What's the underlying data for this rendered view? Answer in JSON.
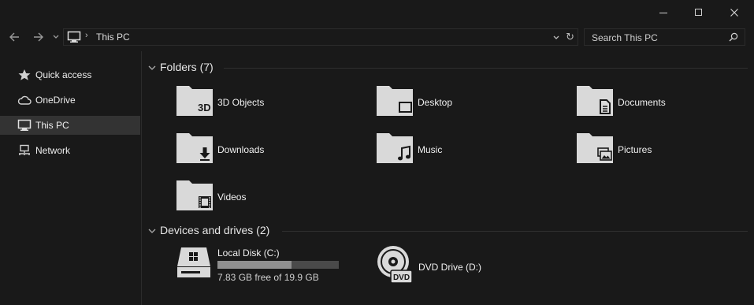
{
  "window": {
    "minimize_icon": "minimize-icon",
    "maximize_icon": "maximize-icon",
    "close_icon": "close-icon"
  },
  "navigation": {
    "back_icon": "arrow-left-icon",
    "forward_icon": "arrow-right-icon",
    "recent_icon": "chevron-down-icon",
    "address": {
      "location_icon": "monitor-icon",
      "separator": "›",
      "path": "This PC",
      "refresh_glyph": "↻"
    },
    "search": {
      "placeholder": "Search This PC",
      "icon": "search-icon"
    }
  },
  "sidebar": {
    "items": [
      {
        "label": "Quick access",
        "icon": "star-icon",
        "selected": false
      },
      {
        "label": "OneDrive",
        "icon": "cloud-icon",
        "selected": false
      },
      {
        "label": "This PC",
        "icon": "monitor-icon",
        "selected": true
      },
      {
        "label": "Network",
        "icon": "network-icon",
        "selected": false
      }
    ]
  },
  "main": {
    "folders_group": {
      "title": "Folders (7)",
      "items": [
        {
          "label": "3D Objects",
          "icon": "3d-objects-folder-icon",
          "glyph": "3D"
        },
        {
          "label": "Desktop",
          "icon": "desktop-folder-icon"
        },
        {
          "label": "Documents",
          "icon": "documents-folder-icon"
        },
        {
          "label": "Downloads",
          "icon": "downloads-folder-icon"
        },
        {
          "label": "Music",
          "icon": "music-folder-icon"
        },
        {
          "label": "Pictures",
          "icon": "pictures-folder-icon"
        },
        {
          "label": "Videos",
          "icon": "videos-folder-icon"
        }
      ]
    },
    "devices_group": {
      "title": "Devices and drives (2)",
      "drives": [
        {
          "label": "Local Disk (C:)",
          "icon": "hard-drive-icon",
          "free_text": "7.83 GB free of 19.9 GB",
          "used_fraction": 0.61
        },
        {
          "label": "DVD Drive (D:)",
          "icon": "dvd-drive-icon",
          "badge": "DVD"
        }
      ]
    }
  },
  "colors": {
    "background": "#191919",
    "selected": "#333333",
    "icon_fill": "#d9d9d9",
    "usage_fill": "#8f8f8f",
    "usage_track": "#4a4a4a"
  }
}
